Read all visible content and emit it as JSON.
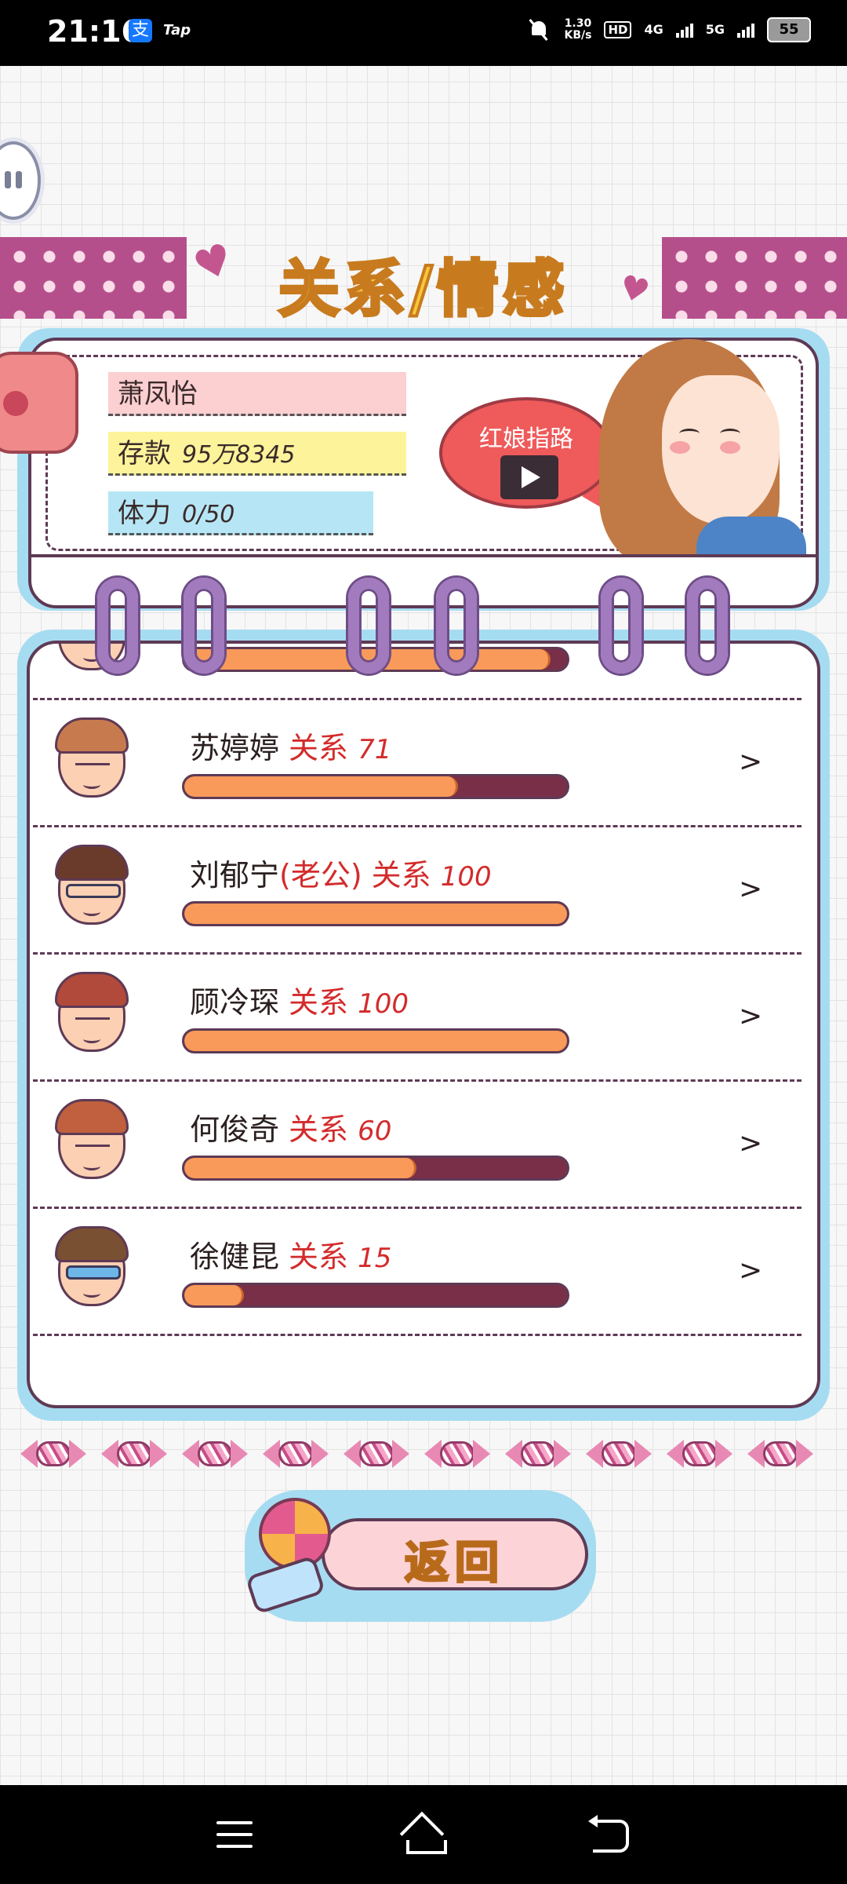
{
  "status_bar": {
    "time": "21:16",
    "alipay_icon": "支",
    "tap_label": "Tap",
    "speed_value": "1.30",
    "speed_unit": "KB/s",
    "hd_label": "HD",
    "network_4g": "4G",
    "network_5g": "5G",
    "battery": "55"
  },
  "header": {
    "title": "关系/情感"
  },
  "profile": {
    "name": "萧凤怡",
    "savings_label": "存款",
    "savings_value": "95万8345",
    "stamina_label": "体力",
    "stamina_value": "0/50",
    "matchmaker_label": "红娘指路"
  },
  "relationships": [
    {
      "name": "",
      "spouse_tag": "",
      "rel_label": "",
      "value": "",
      "level": 0.95,
      "hair": "#c06a3e"
    },
    {
      "name": "苏婷婷",
      "spouse_tag": "",
      "rel_label": "关系",
      "value": "71",
      "level": 0.71,
      "hair": "#c87a4f"
    },
    {
      "name": "刘郁宁",
      "spouse_tag": "(老公)",
      "rel_label": "关系",
      "value": "100",
      "level": 1.0,
      "hair": "#6a3a2a"
    },
    {
      "name": "顾冷琛",
      "spouse_tag": "",
      "rel_label": "关系",
      "value": "100",
      "level": 1.0,
      "hair": "#b14a3a"
    },
    {
      "name": "何俊奇",
      "spouse_tag": "",
      "rel_label": "关系",
      "value": "60",
      "level": 0.6,
      "hair": "#c0603e"
    },
    {
      "name": "徐健昆",
      "spouse_tag": "",
      "rel_label": "关系",
      "value": "15",
      "level": 0.15,
      "hair": "#7a5032"
    }
  ],
  "back_button": {
    "label": "返回"
  },
  "icons": {
    "pause": "pause-icon",
    "video": "video-play-icon",
    "chevron": "chevron-right-icon",
    "nav_menu": "menu-icon",
    "nav_home": "home-icon",
    "nav_back": "back-icon"
  },
  "colors": {
    "title_yellow": "#f8c63a",
    "tape_pink": "#b54f8c",
    "card_border": "#5e3a55",
    "frame_blue": "#a6dcf1",
    "bar_fill": "#f99a5a",
    "bar_track": "#7a2f48",
    "relation_red": "#d42b2b"
  },
  "chevron_symbol": ">"
}
